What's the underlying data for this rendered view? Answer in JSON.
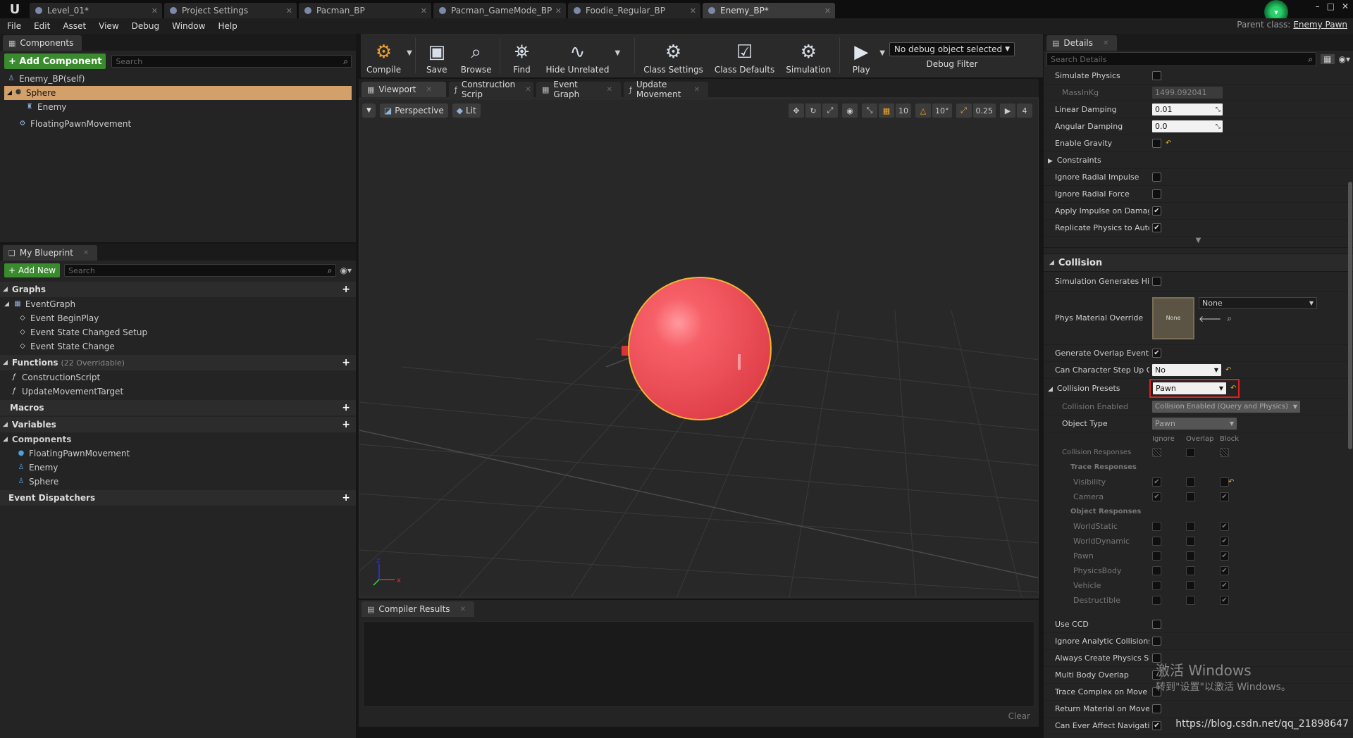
{
  "titlebar": {
    "tabs": [
      {
        "label": "Level_01*",
        "active": false
      },
      {
        "label": "Project Settings",
        "active": false
      },
      {
        "label": "Pacman_BP",
        "active": false
      },
      {
        "label": "Pacman_GameMode_BP",
        "active": false
      },
      {
        "label": "Foodie_Regular_BP",
        "active": false
      },
      {
        "label": "Enemy_BP*",
        "active": true
      }
    ],
    "parent_class_label": "Parent class:",
    "parent_class_value": "Enemy Pawn"
  },
  "menu": [
    "File",
    "Edit",
    "Asset",
    "View",
    "Debug",
    "Window",
    "Help"
  ],
  "components_panel": {
    "tab_label": "Components",
    "add_button": "+ Add Component",
    "search_placeholder": "Search",
    "items": [
      {
        "label": "Enemy_BP(self)"
      },
      {
        "label": "Sphere"
      },
      {
        "label": "Enemy"
      },
      {
        "label": "FloatingPawnMovement"
      }
    ]
  },
  "blueprint_panel": {
    "tab_label": "My Blueprint",
    "add_button": "+ Add New",
    "search_placeholder": "Search",
    "graphs_header": "Graphs",
    "graph_items": [
      "EventGraph",
      "Event BeginPlay",
      "Event State Changed Setup",
      "Event State Change"
    ],
    "functions_header": "Functions",
    "functions_sub": "(22 Overridable)",
    "function_items": [
      "ConstructionScript",
      "UpdateMovementTarget"
    ],
    "macros_header": "Macros",
    "variables_header": "Variables",
    "components_header": "Components",
    "component_items": [
      "FloatingPawnMovement",
      "Enemy",
      "Sphere"
    ],
    "dispatchers_header": "Event Dispatchers"
  },
  "toolbar": {
    "compile": "Compile",
    "save": "Save",
    "browse": "Browse",
    "find": "Find",
    "hide_unrelated": "Hide Unrelated",
    "class_settings": "Class Settings",
    "class_defaults": "Class Defaults",
    "simulation": "Simulation",
    "play": "Play",
    "debug_object": "No debug object selected",
    "debug_filter": "Debug Filter"
  },
  "editor_tabs": [
    "Viewport",
    "Construction Scrip",
    "Event Graph",
    "Update Movement"
  ],
  "viewport": {
    "perspective": "Perspective",
    "lit": "Lit",
    "grid_snap": "10",
    "rot_snap": "10°",
    "scale_snap": "0.25",
    "cam_speed": "4"
  },
  "compiler": {
    "tab_label": "Compiler Results",
    "clear": "Clear"
  },
  "details": {
    "tab_label": "Details",
    "search_placeholder": "Search Details",
    "physics_rows": [
      {
        "name": "Simulate Physics",
        "type": "check",
        "checked": false
      },
      {
        "name": "MassInKg",
        "type": "num-ro",
        "value": "1499.092041"
      },
      {
        "name": "Linear Damping",
        "type": "num",
        "value": "0.01"
      },
      {
        "name": "Angular Damping",
        "type": "num",
        "value": "0.0"
      },
      {
        "name": "Enable Gravity",
        "type": "check",
        "checked": false
      },
      {
        "name": "Constraints",
        "type": "group"
      },
      {
        "name": "Ignore Radial Impulse",
        "type": "check",
        "checked": false
      },
      {
        "name": "Ignore Radial Force",
        "type": "check",
        "checked": false
      },
      {
        "name": "Apply Impulse on Damage",
        "type": "check",
        "checked": true
      },
      {
        "name": "Replicate Physics to Auto",
        "type": "check",
        "checked": true
      }
    ],
    "collision_header": "Collision",
    "sim_gen_hit": "Simulation Generates Hit",
    "phys_mat_override": "Phys Material Override",
    "phys_mat_thumb": "None",
    "phys_mat_value": "None",
    "gen_overlap": "Generate Overlap Events",
    "can_step_up": "Can Character Step Up On",
    "can_step_up_value": "No",
    "collision_presets": "Collision Presets",
    "collision_presets_value": "Pawn",
    "collision_enabled": "Collision Enabled",
    "collision_enabled_value": "Collision Enabled (Query and Physics)",
    "object_type": "Object Type",
    "object_type_value": "Pawn",
    "col_ignore": "Ignore",
    "col_overlap": "Overlap",
    "col_block": "Block",
    "collision_responses": "Collision Responses",
    "trace_responses": "Trace Responses",
    "trace_items": [
      {
        "name": "Visibility",
        "block": false
      },
      {
        "name": "Camera",
        "block": true
      }
    ],
    "object_responses": "Object Responses",
    "object_items": [
      "WorldStatic",
      "WorldDynamic",
      "Pawn",
      "PhysicsBody",
      "Vehicle",
      "Destructible"
    ],
    "bottom_rows": [
      {
        "name": "Use CCD",
        "checked": false
      },
      {
        "name": "Ignore Analytic Collisions",
        "checked": false
      },
      {
        "name": "Always Create Physics St",
        "checked": false
      },
      {
        "name": "Multi Body Overlap",
        "checked": false
      },
      {
        "name": "Trace Complex on Move",
        "checked": false
      },
      {
        "name": "Return Material on Move",
        "checked": false
      },
      {
        "name": "Can Ever Affect Navigatio",
        "checked": true
      }
    ]
  },
  "watermark": {
    "line1": "激活 Windows",
    "line2": "转到\"设置\"以激活 Windows。"
  },
  "url": "https://blog.csdn.net/qq_21898647",
  "colors": {
    "accent_green": "#3a8a2e",
    "sphere": "#f0505a",
    "selection": "#d4a06a",
    "highlight_red": "#e02020"
  }
}
